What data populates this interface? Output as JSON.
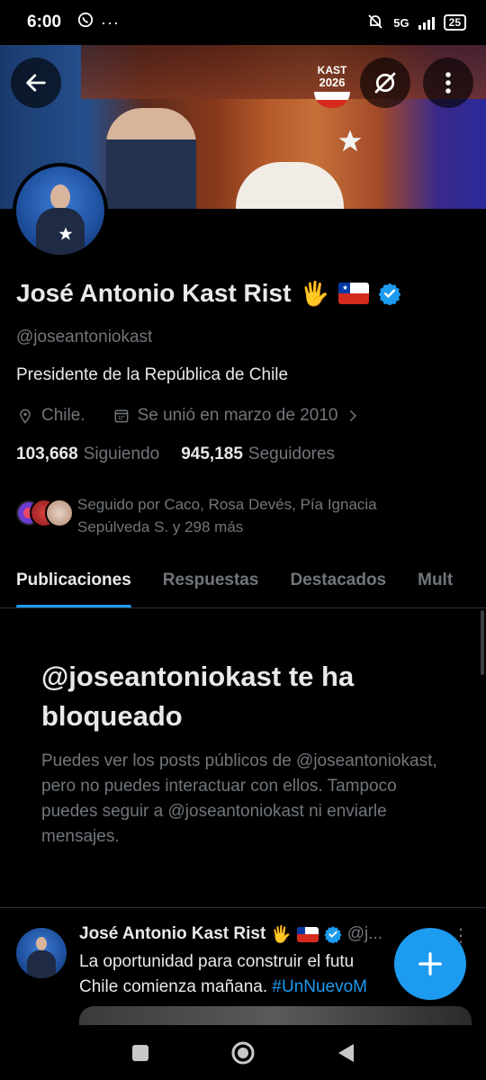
{
  "status_bar": {
    "time": "6:00",
    "network": "5G",
    "battery": "25",
    "icons": [
      "whatsapp-icon",
      "more-dots-icon",
      "mute-bell-icon",
      "signal-icon",
      "battery-icon"
    ]
  },
  "banner": {
    "logo_line1": "KAST",
    "logo_line2": "2026"
  },
  "profile": {
    "name": "José Antonio Kast Rist",
    "name_emoji": "🖐",
    "handle": "@joseantoniokast",
    "bio": "Presidente de la República de Chile",
    "location": "Chile.",
    "joined": "Se unió en marzo de 2010",
    "following_count": "103,668",
    "following_label": "Siguiendo",
    "followers_count": "945,185",
    "followers_label": "Seguidores",
    "followed_by": "Seguido por Caco, Rosa Devés, Pía Ignacia Sepúlveda S. y 298 más"
  },
  "tabs": [
    {
      "label": "Publicaciones",
      "active": true
    },
    {
      "label": "Respuestas",
      "active": false
    },
    {
      "label": "Destacados",
      "active": false
    },
    {
      "label": "Mult",
      "active": false
    }
  ],
  "blocked": {
    "title": "@joseantoniokast te ha bloqueado",
    "body": "Puedes ver los posts públicos de @joseantoniokast, pero no puedes interactuar con ellos. Tampoco puedes seguir a @joseantoniokast ni enviarle mensajes."
  },
  "post": {
    "author": "José Antonio Kast Rist",
    "emoji": "🖐",
    "handle": "@j...",
    "text": "La oportunidad para construir el futu",
    "text_line2": "Chile comienza mañana.",
    "hashtag": "#UnNuevoM"
  },
  "colors": {
    "accent": "#1d9bf0",
    "background": "#000000",
    "text_primary": "#e7e9ea",
    "text_secondary": "#71767b",
    "border": "#2f3336"
  }
}
